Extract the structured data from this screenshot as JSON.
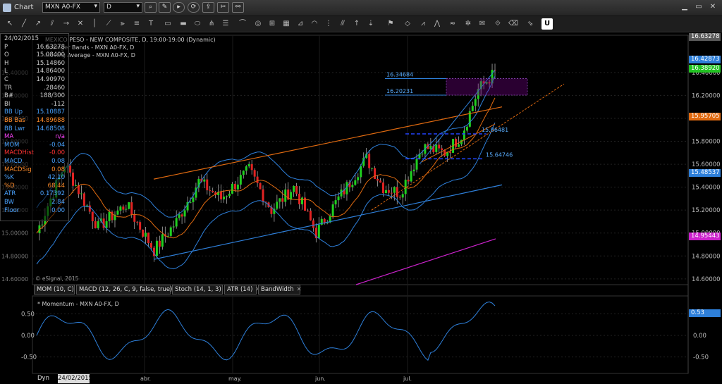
{
  "window": {
    "title": "Chart",
    "symbol": "MXN A0-FX",
    "interval": "D"
  },
  "chart": {
    "title_line1": "MEXICO PESO - NEW COMPOSITE, D, 19:00-19:00 (Dynamic)",
    "title_line2": "Bollinger Bands - MXN A0-FX, D",
    "title_line3": "Moving Average - MXN A0-FX, D",
    "copyright": "© eSignal, 2015",
    "last_price_badge": "16.63278",
    "price_labels": [
      "16.40000",
      "16.20000",
      "16.00000",
      "15.80000",
      "15.60000",
      "15.40000",
      "15.20000",
      "15.00000",
      "14.80000",
      "14.60000"
    ],
    "month_labels": [
      "abr.",
      "may.",
      "jun.",
      "jul."
    ],
    "annotations": [
      "16.34684",
      "16.20231",
      "15.86481",
      "15.64746"
    ]
  },
  "right_badges": [
    {
      "text": "16.63278",
      "color": "#5a5a5a"
    },
    {
      "text": "16.42873",
      "color": "#2e7fd9"
    },
    {
      "text": "16.38920",
      "color": "#22c322"
    },
    {
      "text": "15.95705",
      "color": "#e06a10"
    },
    {
      "text": "15.48537",
      "color": "#2e7fd9"
    },
    {
      "text": "14.95443",
      "color": "#cc22cc"
    }
  ],
  "data_window": [
    {
      "label": "24/02/2015",
      "value": "",
      "color": "#ccc"
    },
    {
      "label": "P",
      "value": "16.63278",
      "color": "#ccc"
    },
    {
      "label": "O",
      "value": "15.08400",
      "color": "#ccc"
    },
    {
      "label": "H",
      "value": "15.14860",
      "color": "#ccc"
    },
    {
      "label": "L",
      "value": "14.86400",
      "color": "#ccc"
    },
    {
      "label": "C",
      "value": "14.90970",
      "color": "#ccc"
    },
    {
      "label": "TR",
      "value": ".28460",
      "color": "#ccc"
    },
    {
      "label": "B#",
      "value": "188/300",
      "color": "#ccc"
    },
    {
      "label": "BI",
      "value": "-112",
      "color": "#ccc"
    },
    {
      "label": "BB Up",
      "value": "15.10887",
      "color": "#4aa3ff"
    },
    {
      "label": "BB Bas",
      "value": "14.89688",
      "color": "#ff8c2a"
    },
    {
      "label": "BB Lwr",
      "value": "14.68508",
      "color": "#4aa3ff"
    },
    {
      "label": "MA",
      "value": "n/a",
      "color": "#ff44ff"
    },
    {
      "label": "MOM",
      "value": "-0.04",
      "color": "#4aa3ff"
    },
    {
      "label": "MACDHist",
      "value": "-0.00",
      "color": "#ff3333"
    },
    {
      "label": "MACD",
      "value": "0.08",
      "color": "#4aa3ff"
    },
    {
      "label": "MACDSig",
      "value": "0.08",
      "color": "#ff8c2a"
    },
    {
      "label": "%K",
      "value": "42.10",
      "color": "#4aa3ff"
    },
    {
      "label": "%D",
      "value": "68.44",
      "color": "#ff8c2a"
    },
    {
      "label": "ATR",
      "value": "0.17392",
      "color": "#4aa3ff"
    },
    {
      "label": "BW",
      "value": "2.84",
      "color": "#4aa3ff"
    },
    {
      "label": "Floor",
      "value": "0.00",
      "color": "#4aa3ff"
    }
  ],
  "study_tabs": [
    "MOM (10, C)",
    "MACD (12, 26, C, 9, false, true)",
    "Stoch (14, 1, 3)",
    "ATR (14)",
    "BandWidth"
  ],
  "momentum": {
    "title": "* Momentum - MXN A0-FX, D",
    "labels": [
      "0.50",
      "0.00",
      "-0.50"
    ],
    "badge": "0.53"
  },
  "footer": {
    "dyn": "Dyn",
    "date": "24/02/2015"
  },
  "chart_data": {
    "type": "candlestick",
    "instrument": "MXN A0-FX",
    "x_labels": [
      "abr.",
      "may.",
      "jun.",
      "jul."
    ],
    "ylim": [
      14.55,
      16.7
    ],
    "y_ticks": [
      14.6,
      14.8,
      15.0,
      15.2,
      15.4,
      15.6,
      15.8,
      16.0,
      16.2,
      16.4
    ],
    "momentum_ylim": [
      -0.85,
      0.85
    ],
    "momentum_ticks": [
      0.5,
      0.0,
      -0.5
    ]
  }
}
